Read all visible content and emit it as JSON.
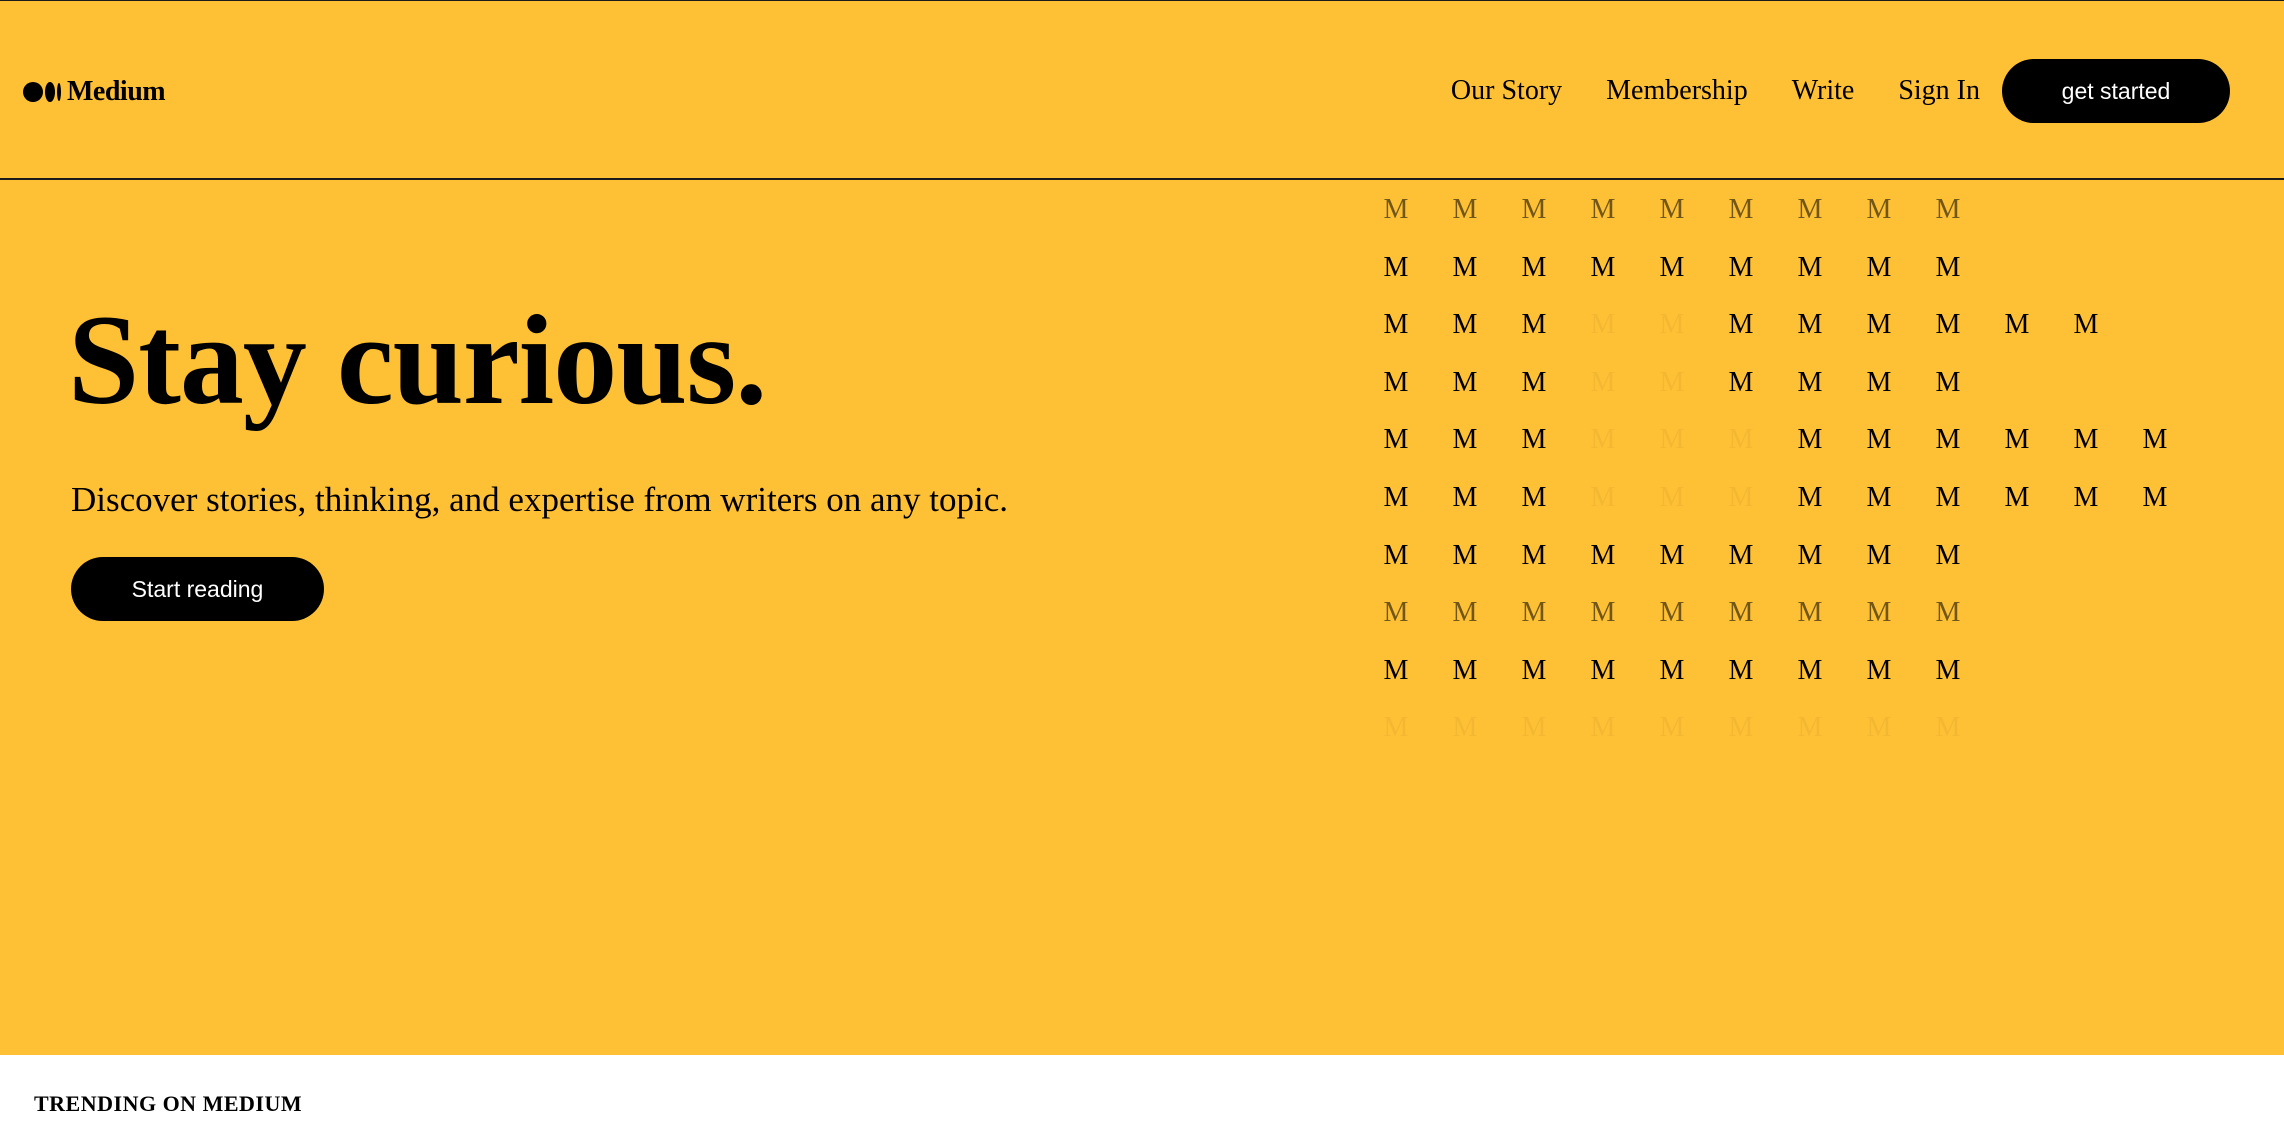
{
  "brand": {
    "name": "Medium"
  },
  "nav": {
    "links": [
      "Our Story",
      "Membership",
      "Write",
      "Sign In"
    ],
    "cta_label": "get started"
  },
  "hero": {
    "title": "Stay curious.",
    "subtitle": "Discover stories, thinking, and expertise from writers on any topic.",
    "button_label": "Start reading"
  },
  "pattern": {
    "glyph": "M",
    "rows": [
      [
        0.55,
        0.55,
        0.55,
        0.55,
        0.55,
        0.55,
        0.55,
        0.55,
        0.55,
        0,
        0,
        0
      ],
      [
        1,
        1,
        1,
        1,
        1,
        1,
        1,
        1,
        1,
        0,
        0,
        0
      ],
      [
        1,
        1,
        1,
        0.04,
        0.04,
        1,
        1,
        1,
        1,
        1,
        1,
        0
      ],
      [
        1,
        1,
        1,
        0.04,
        0.04,
        1,
        1,
        1,
        1,
        0,
        0,
        0
      ],
      [
        1,
        1,
        1,
        0.04,
        0.04,
        0.04,
        1,
        1,
        1,
        1,
        1,
        1
      ],
      [
        1,
        1,
        1,
        0.04,
        0.04,
        0.04,
        1,
        1,
        1,
        1,
        1,
        1
      ],
      [
        1,
        1,
        1,
        1,
        1,
        1,
        1,
        1,
        1,
        0,
        0,
        0
      ],
      [
        0.55,
        0.55,
        0.55,
        0.55,
        0.55,
        0.55,
        0.55,
        0.55,
        0.55,
        0,
        0,
        0
      ],
      [
        1,
        1,
        1,
        1,
        1,
        1,
        1,
        1,
        1,
        0,
        0,
        0
      ],
      [
        0.04,
        0.04,
        0.04,
        0.04,
        0.04,
        0.04,
        0.04,
        0.04,
        0.04,
        0,
        0,
        0
      ]
    ]
  },
  "trending": {
    "heading": "TRENDING ON MEDIUM"
  },
  "colors": {
    "hero_background": "#fec035",
    "button_background": "#000000",
    "button_text": "#ffffff",
    "page_background": "#ffffff"
  }
}
